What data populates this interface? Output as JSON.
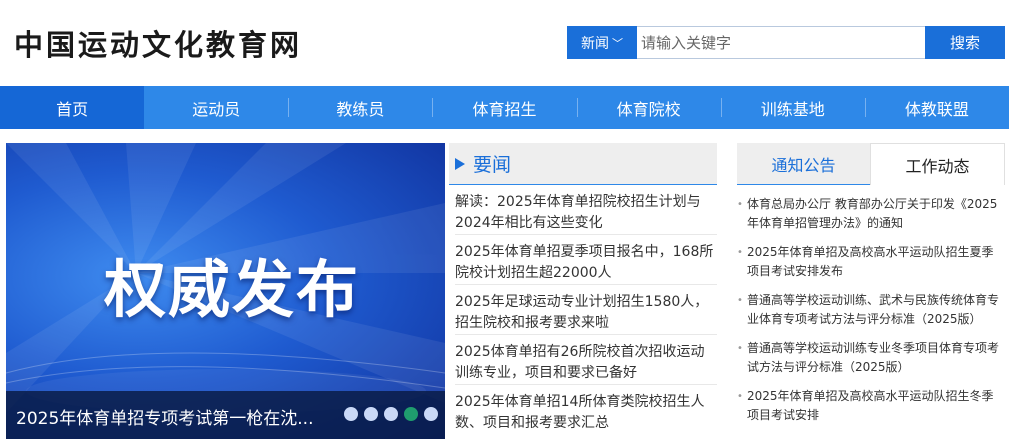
{
  "site": {
    "logo_text": "中国运动文化教育网"
  },
  "search": {
    "category": "新闻",
    "placeholder": "请输入关键字",
    "button_label": "搜索"
  },
  "nav": {
    "items": [
      {
        "label": "首页",
        "active": true
      },
      {
        "label": "运动员"
      },
      {
        "label": "教练员"
      },
      {
        "label": "体育招生"
      },
      {
        "label": "体育院校"
      },
      {
        "label": "训练基地"
      },
      {
        "label": "体教联盟"
      }
    ]
  },
  "banner": {
    "headline": "权威发布",
    "caption": "2025年体育单招专项考试第一枪在沈...",
    "slide_count": 5,
    "active_slide": 4
  },
  "news": {
    "title": "要闻",
    "items": [
      "解读：2025年体育单招院校招生计划与2024年相比有这些变化",
      "2025年体育单招夏季项目报名中，168所院校计划招生超22000人",
      "2025年足球运动专业计划招生1580人，招生院校和报考要求来啦",
      "2025体育单招有26所院校首次招收运动训练专业，项目和要求已备好",
      "2025年体育单招14所体育类院校招生人数、项目和报考要求汇总"
    ]
  },
  "notice": {
    "tabs": [
      "通知公告",
      "工作动态"
    ],
    "items": [
      "体育总局办公厅 教育部办公厅关于印发《2025年体育单招管理办法》的通知",
      "2025年体育单招及高校高水平运动队招生夏季项目考试安排发布",
      "普通高等学校运动训练、武术与民族传统体育专业体育专项考试方法与评分标准（2025版）",
      "普通高等学校运动训练专业冬季项目体育专项考试方法与评分标准（2025版）",
      "2025年体育单招及高校高水平运动队招生冬季项目考试安排"
    ]
  },
  "colors": {
    "accent": "#1a6fd9",
    "nav_bg": "#2e88e8",
    "nav_active": "#1567d6"
  }
}
